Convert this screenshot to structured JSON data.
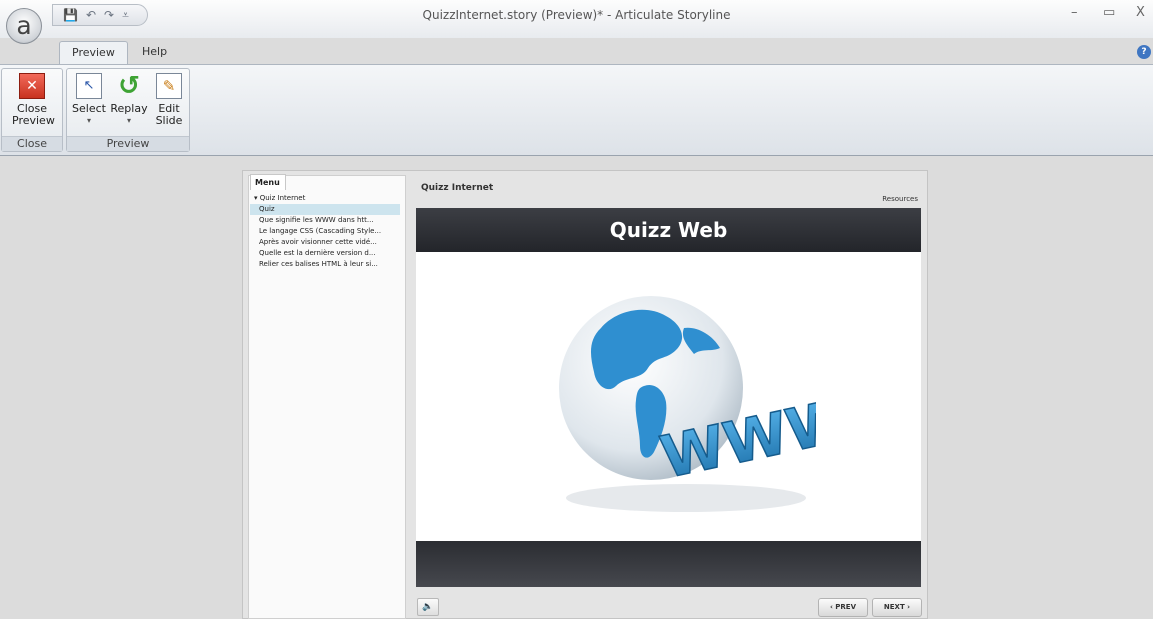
{
  "window": {
    "title": "QuizzInternet.story (Preview)* -  Articulate Storyline",
    "app_logo": "a",
    "minimize": "–",
    "maximize": "▭",
    "close": "X"
  },
  "quick_access": {
    "save_icon": "💾",
    "undo_icon": "↶",
    "redo_icon": "↷",
    "customize_icon": "⩡"
  },
  "tabs": [
    {
      "label": "Preview"
    },
    {
      "label": "Help"
    }
  ],
  "help_icon": "?",
  "ribbon": {
    "groups": [
      {
        "label": "Close",
        "buttons": [
          {
            "line1": "Close",
            "line2": "Preview",
            "icon": "x-icon",
            "glyph": "✕"
          }
        ]
      },
      {
        "label": "Preview",
        "buttons": [
          {
            "line1": "Select",
            "line2": "▾",
            "icon": "select-icon",
            "glyph": "↖"
          },
          {
            "line1": "Replay",
            "line2": "▾",
            "icon": "replay-icon",
            "glyph": "↺"
          },
          {
            "line1": "Edit",
            "line2": "Slide",
            "icon": "edit-slide-icon",
            "glyph": "✎"
          }
        ]
      }
    ]
  },
  "player": {
    "menu_tab": "Menu",
    "course_title": "Quizz Internet",
    "resources": "Resources",
    "menu": {
      "root": "▾ Quiz Internet",
      "items": [
        {
          "label": "Quiz",
          "selected": true
        },
        {
          "label": "Que signifie les WWW dans htt...",
          "selected": false
        },
        {
          "label": "Le langage CSS (Cascading Style...",
          "selected": false
        },
        {
          "label": "Après avoir visionner cette vidé...",
          "selected": false
        },
        {
          "label": "Quelle est la dernière version d...",
          "selected": false
        },
        {
          "label": "Relier ces balises HTML à leur si...",
          "selected": false
        }
      ]
    },
    "slide": {
      "heading": "Quizz Web",
      "image_text": "WWW"
    },
    "controls": {
      "volume_icon": "🔈",
      "prev_label": "‹ PREV",
      "next_label": "NEXT ›"
    }
  },
  "colors": {
    "accent_blue": "#3f76c2",
    "slide_bar": "#2e3035",
    "selected_menu": "#cde4ee",
    "globe_blue": "#2f8fd0"
  }
}
